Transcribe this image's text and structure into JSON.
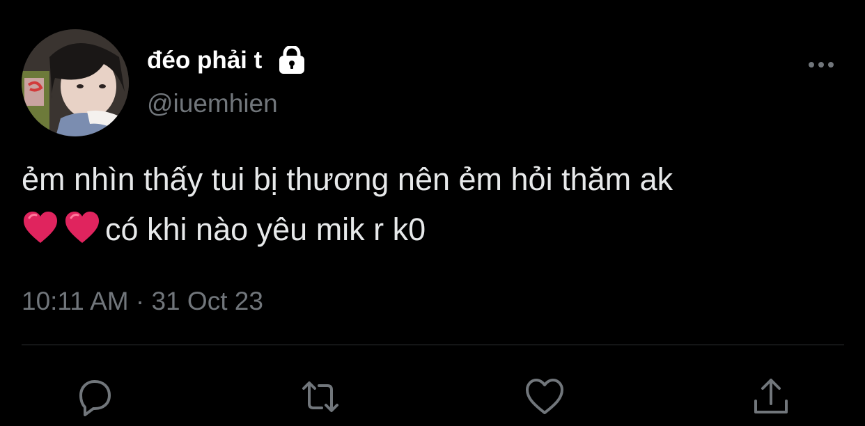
{
  "tweet": {
    "display_name": "đéo phải t",
    "handle": "@iuemhien",
    "text_line_1": "ẻm nhìn thấy tui bị thương nên ẻm hỏi thăm ak",
    "text_line_2": "có khi nào yêu mik r k0",
    "emoji": [
      "red-heart",
      "red-heart"
    ],
    "time": "10:11 AM",
    "separator": "·",
    "date": "31 Oct 23"
  },
  "icons": {
    "lock": "lock-icon",
    "more": "more-icon",
    "reply": "reply-icon",
    "retweet": "retweet-icon",
    "like": "like-icon",
    "share": "share-icon"
  },
  "colors": {
    "background": "#000000",
    "primary_text": "#e7e9ea",
    "secondary_text": "#71767b",
    "divider": "#2f3336",
    "heart": "#e0245e"
  }
}
